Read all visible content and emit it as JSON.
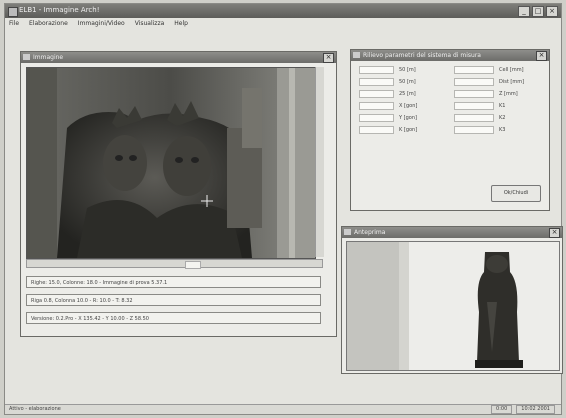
{
  "app": {
    "title": "ELB1 - Immagine Arch!"
  },
  "menu": [
    "File",
    "Elaborazione",
    "Immagini/Video",
    "Visualizza",
    "Help"
  ],
  "image_window": {
    "title": "Immagine",
    "status_lines": [
      "Righe: 15.0, Colonne: 18.0 - Immagine di prova 5.37.1",
      "Riga 0.8, Colonna 10.0 - R: 10.0 - T: 8.32",
      "Versione: 0.2.Pro - X 135.42 - Y 10.00 - Z 58.50"
    ]
  },
  "info_window": {
    "title": "Rilievo parametri del sistema di misura",
    "rows": [
      {
        "v1": "",
        "v2": "50 [m]",
        "v3": "",
        "v4": "Cell [mm]"
      },
      {
        "v1": "",
        "v2": "50 [m]",
        "v3": "",
        "v4": "Dist [mm]"
      },
      {
        "v1": "",
        "v2": "25 [m]",
        "v3": "",
        "v4": "Z [mm]"
      },
      {
        "v1": "",
        "v2": "X [gon]",
        "v3": "",
        "v4": "K1"
      },
      {
        "v1": "",
        "v2": "Y [gon]",
        "v3": "",
        "v4": "K2"
      },
      {
        "v1": "",
        "v2": "K [gon]",
        "v3": "",
        "v4": "K3"
      }
    ],
    "ok_button": "Ok/Chiudi"
  },
  "preview_window": {
    "title": "Anteprima"
  },
  "statusbar": {
    "left": "Attivo - elaborazione",
    "mid": "0:00",
    "right": "10:02 2001"
  }
}
